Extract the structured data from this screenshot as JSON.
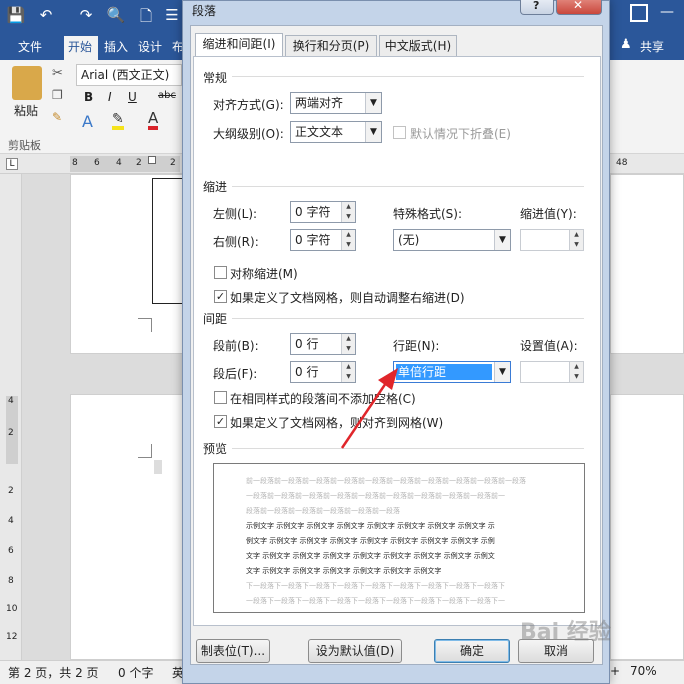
{
  "word": {
    "tabs": [
      "文件",
      "开始",
      "插入",
      "设计",
      "布"
    ],
    "share": "共享",
    "font_name": "Arial (西文正文)",
    "paste_label": "粘贴",
    "clipboard_label": "剪贴板",
    "format_buttons": [
      "B",
      "I",
      "U",
      "abc"
    ],
    "ruler_left": [
      "8",
      "6",
      "4",
      "2",
      "2"
    ],
    "ruler_right": "48",
    "vruler": [
      "4",
      "2",
      "2",
      "4",
      "6",
      "8",
      "10",
      "12"
    ],
    "status": {
      "page": "第 2 页，共 2 页",
      "words": "0 个字",
      "lang": "英",
      "zoom": "70%"
    }
  },
  "dialog": {
    "title": "段落",
    "tabs": [
      "缩进和间距(I)",
      "换行和分页(P)",
      "中文版式(H)"
    ],
    "general": {
      "heading": "常规",
      "alignment_label": "对齐方式(G):",
      "alignment_value": "两端对齐",
      "outline_label": "大纲级别(O):",
      "outline_value": "正文文本",
      "collapse_label": "默认情况下折叠(E)"
    },
    "indent": {
      "heading": "缩进",
      "left_label": "左侧(L):",
      "left_value": "0 字符",
      "right_label": "右侧(R):",
      "right_value": "0 字符",
      "special_label": "特殊格式(S):",
      "special_value": "(无)",
      "by_label": "缩进值(Y):",
      "mirror_label": "对称缩进(M)",
      "auto_adjust_label": "如果定义了文档网格，则自动调整右缩进(D)"
    },
    "spacing": {
      "heading": "间距",
      "before_label": "段前(B):",
      "before_value": "0 行",
      "after_label": "段后(F):",
      "after_value": "0 行",
      "line_label": "行距(N):",
      "line_value": "单倍行距",
      "at_label": "设置值(A):",
      "no_space_label": "在相同样式的段落间不添加空格(C)",
      "snap_grid_label": "如果定义了文档网格，则对齐到网格(W)"
    },
    "preview": {
      "heading": "预览",
      "prev_lines": [
        "前一段落前一段落前一段落前一段落前一段落前一段落前一段落前一段落前一段落前一段落",
        "一段落前一段落前一段落前一段落前一段落前一段落前一段落前一段落前一段落前一",
        "段落前一段落前一段落前一段落前一段落前一段落"
      ],
      "sample_lines": [
        "示例文字 示例文字 示例文字 示例文字 示例文字 示例文字 示例文字 示例文字 示",
        "例文字 示例文字 示例文字 示例文字 示例文字 示例文字 示例文字 示例文字 示例",
        "文字 示例文字 示例文字 示例文字 示例文字 示例文字 示例文字 示例文字 示例文",
        "文字 示例文字 示例文字 示例文字 示例文字 示例文字 示例文字"
      ],
      "next_lines": [
        "下一段落下一段落下一段落下一段落下一段落下一段落下一段落下一段落下一段落下",
        "一段落下一段落下一段落下一段落下一段落下一段落下一段落下一段落下一段落下一",
        "段落下一段落下一段落下一段落下一段落下一段落下一段落下一段落下一段落下一段",
        "落下一段落下一段落下一段落下一段落下一段落下一段落下一段落下一段落下一段落"
      ]
    },
    "buttons": {
      "tabs": "制表位(T)...",
      "default": "设为默认值(D)",
      "ok": "确定",
      "cancel": "取消"
    }
  },
  "watermark": "Bai 经验",
  "colors": {
    "word_blue": "#2b579a",
    "selection": "#3399ff",
    "arrow": "#e0262b",
    "close_red": "#c9473c"
  }
}
